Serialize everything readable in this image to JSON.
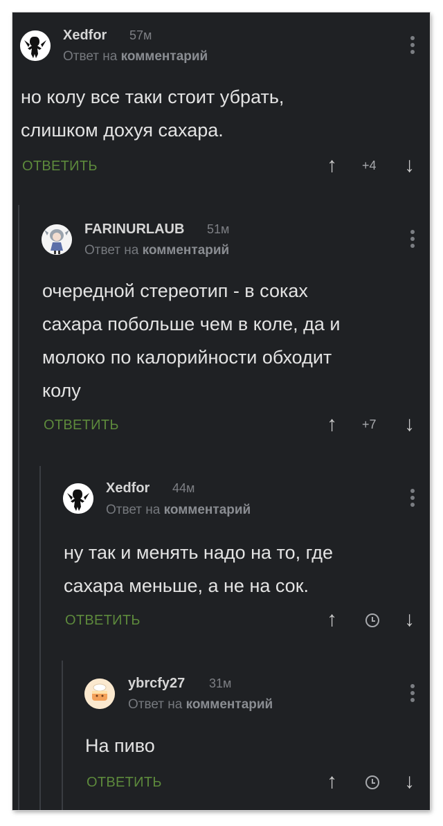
{
  "reply_to_prefix": "Ответ на",
  "reply_to_link": "комментарий",
  "reply_label": "ОТВЕТИТЬ",
  "comments": [
    {
      "username": "Xedfor",
      "time": "57м",
      "text": "но колу все таки стоит убрать,\nслишком дохуя сахара.",
      "score": "+4",
      "score_icon": "text",
      "avatar": "silhouette-avatar"
    },
    {
      "username": "FARINURLAUB",
      "time": "51м",
      "text": "очередной стереотип - в соках\nсахара побольше чем в коле, да и\nмолоко по калорийности обходит\nколу",
      "score": "+7",
      "score_icon": "text",
      "avatar": "anime-girl-avatar"
    },
    {
      "username": "Xedfor",
      "time": "44м",
      "text": "ну так и менять надо на то, где\nсахара меньше, а не на сок.",
      "score": "",
      "score_icon": "clock-icon",
      "avatar": "silhouette-avatar"
    },
    {
      "username": "ybrcfy27",
      "time": "31м",
      "text": "На пиво",
      "score": "",
      "score_icon": "clock-icon",
      "avatar": "cake-avatar"
    }
  ],
  "colors": {
    "background": "#1f2124",
    "reply_green": "#5d8a3c",
    "text": "#e3e3e3",
    "thread_line": "#3a3d42"
  }
}
